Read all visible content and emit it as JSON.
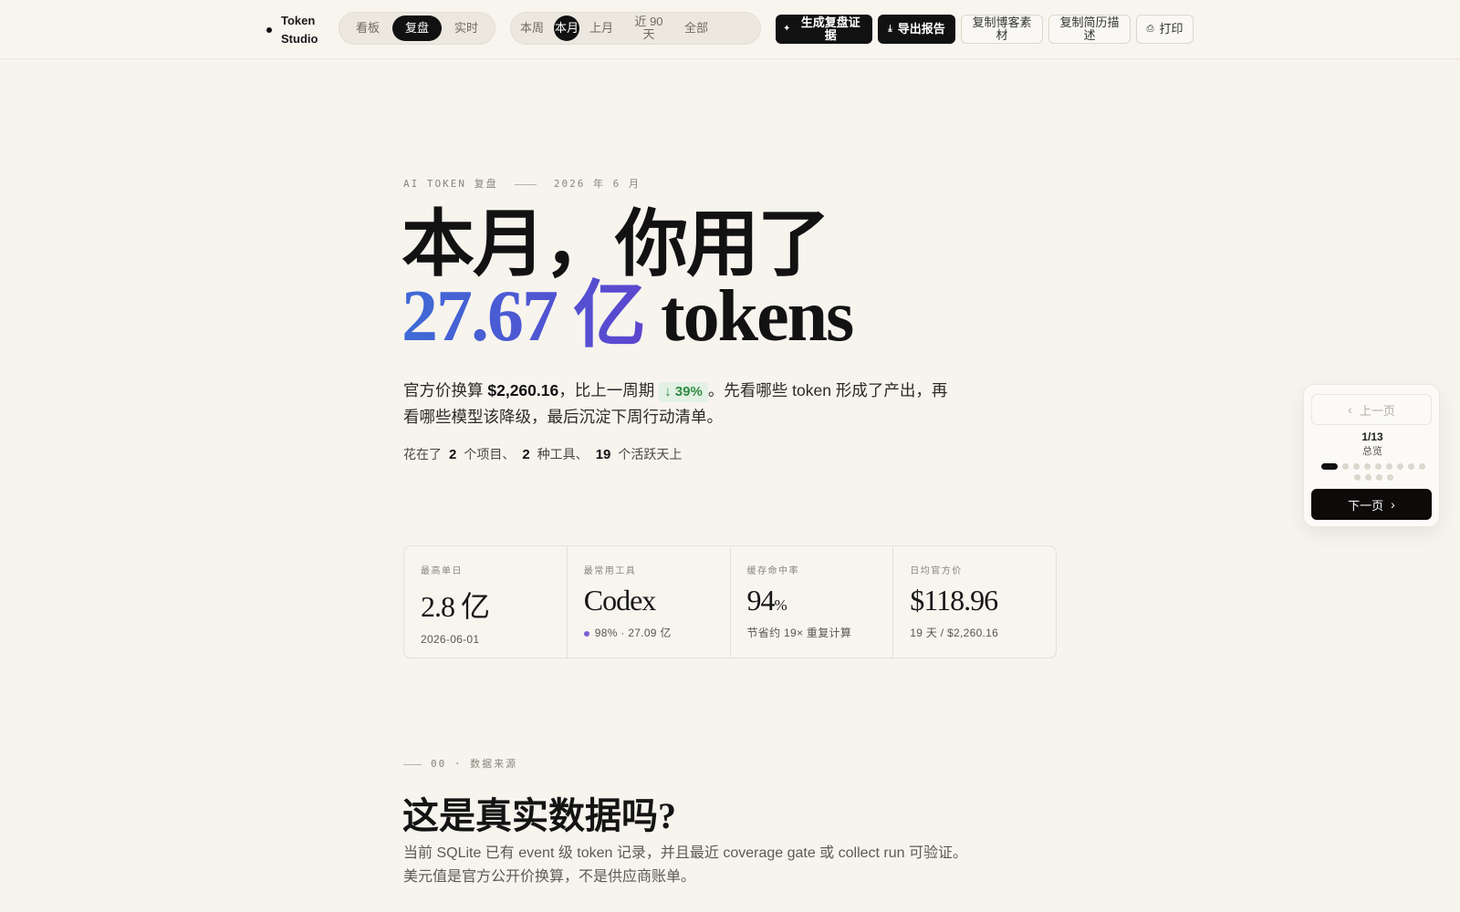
{
  "brand": {
    "name": "Token Studio"
  },
  "view_tabs": [
    {
      "label": "看板",
      "active": false
    },
    {
      "label": "复盘",
      "active": true
    },
    {
      "label": "实时",
      "active": false
    }
  ],
  "range_tabs": [
    {
      "label": "本周",
      "active": false
    },
    {
      "label": "本月",
      "active": true
    },
    {
      "label": "上月",
      "active": false
    },
    {
      "label": "近 90 天",
      "active": false
    },
    {
      "label": "全部",
      "active": false
    }
  ],
  "actions": {
    "generate_evidence": "生成复盘证据",
    "export_report": "导出报告",
    "copy_blog": "复制博客素材",
    "copy_resume": "复制简历描述",
    "print": "打印"
  },
  "hero": {
    "eyebrow_left": "AI TOKEN 复盘",
    "eyebrow_right": "2026 年 6 月",
    "headline_prefix": "本月，你用了",
    "headline_accent": "27.67 亿",
    "headline_suffix": "tokens",
    "summary_prefix": "官方价换算",
    "summary_amount": "$2,260.16",
    "summary_compare": "，比上一周期",
    "summary_change": "39%",
    "summary_rest": "。先看哪些 token 形成了产出，再看哪些模型该降级，最后沉淀下周行动清单。",
    "stats_prefix": "花在了",
    "projects_count": "2",
    "projects_label": "个项目、",
    "tools_count": "2",
    "tools_label": "种工具、",
    "days_count": "19",
    "days_label": "个活跃天上"
  },
  "kpis": [
    {
      "label": "最高单日",
      "value": "2.8 亿",
      "unit": "",
      "sub": "2026-06-01",
      "dot": false
    },
    {
      "label": "最常用工具",
      "value": "Codex",
      "unit": "",
      "sub": "98% · 27.09 亿",
      "dot": true
    },
    {
      "label": "缓存命中率",
      "value": "94",
      "unit": "%",
      "sub": "节省约 19× 重复计算",
      "dot": false
    },
    {
      "label": "日均官方价",
      "value": "$118.96",
      "unit": "",
      "sub": "19 天 / $2,260.16",
      "dot": false
    }
  ],
  "section": {
    "number": "00",
    "eyebrow": "数据来源",
    "title": "这是真实数据吗?",
    "body": "当前 SQLite 已有 event 级 token 记录，并且最近 coverage gate 或 collect run 可验证。美元值是官方公开价换算，不是供应商账单。"
  },
  "pager": {
    "prev_label": "上一页",
    "count": "1/13",
    "label": "总览",
    "total": 13,
    "current": 1,
    "next_label": "下一页"
  },
  "colors": {
    "background": "#f7f4ee",
    "accent_start": "#3e6ad6",
    "accent_end": "#5c46cf",
    "down_green": "#2f8b44",
    "tool_dot": "#7b5fd6"
  }
}
